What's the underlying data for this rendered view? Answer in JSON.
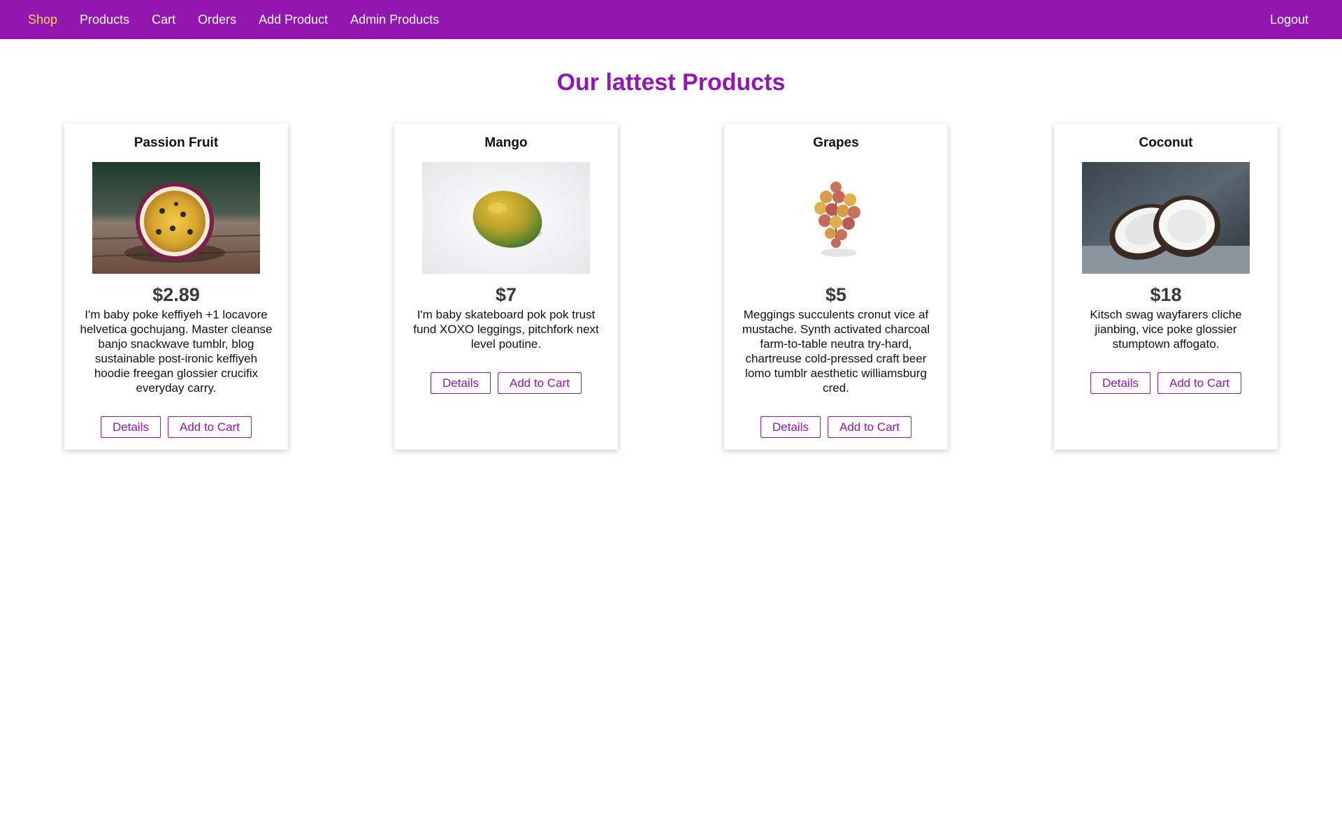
{
  "nav": {
    "links": [
      {
        "label": "Shop"
      },
      {
        "label": "Products"
      },
      {
        "label": "Cart"
      },
      {
        "label": "Orders"
      },
      {
        "label": "Add Product"
      },
      {
        "label": "Admin Products"
      }
    ],
    "logout_label": "Logout",
    "active_color": "#ffd54f",
    "background_color": "#9216b0"
  },
  "page": {
    "title": "Our lattest Products"
  },
  "products": [
    {
      "title": "Passion Fruit",
      "image_icon": "passion-fruit-image",
      "price": "$2.89",
      "description": "I'm baby poke keffiyeh +1 locavore helvetica gochujang. Master cleanse banjo snackwave tumblr, blog sustainable post-ironic keffiyeh hoodie freegan glossier crucifix everyday carry.",
      "details_label": "Details",
      "add_label": "Add to Cart"
    },
    {
      "title": "Mango",
      "image_icon": "mango-image",
      "price": "$7",
      "description": "I'm baby skateboard pok pok trust fund XOXO leggings, pitchfork next level poutine.",
      "details_label": "Details",
      "add_label": "Add to Cart"
    },
    {
      "title": "Grapes",
      "image_icon": "grapes-image",
      "price": "$5",
      "description": "Meggings succulents cronut vice af mustache. Synth activated charcoal farm-to-table neutra try-hard, chartreuse cold-pressed craft beer lomo tumblr aesthetic williamsburg cred.",
      "details_label": "Details",
      "add_label": "Add to Cart"
    },
    {
      "title": "Coconut",
      "image_icon": "coconut-image",
      "price": "$18",
      "description": "Kitsch swag wayfarers cliche jianbing, vice poke glossier stumptown affogato.",
      "details_label": "Details",
      "add_label": "Add to Cart"
    }
  ]
}
